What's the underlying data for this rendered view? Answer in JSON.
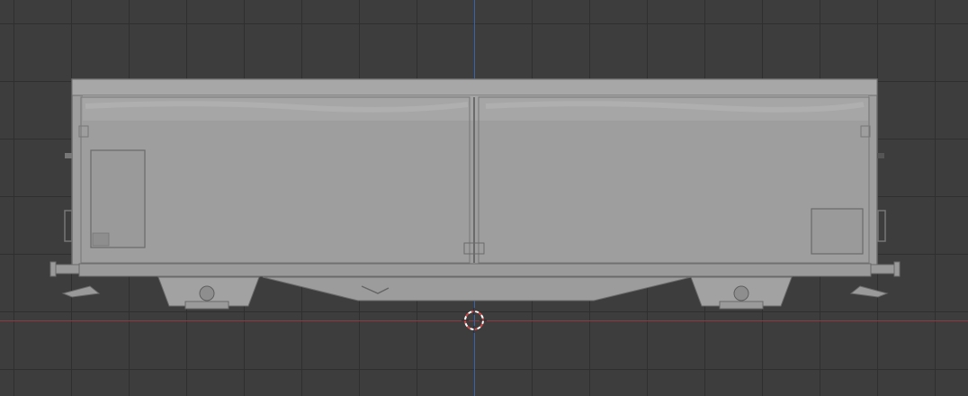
{
  "viewport": {
    "background_color": "#3d3d3d",
    "grid_color": "#2f2f2f",
    "x_axis_color": "#8e3a44",
    "y_axis_color": "#3a62a8"
  },
  "model": {
    "subject": "boxcar-freight-wagon",
    "body_color": "#9c9c9c",
    "shade_color": "#8a8a8a",
    "outline_color": "#6a6a6a"
  },
  "cursor": {
    "icon": "3d-cursor-icon",
    "ring_colors": [
      "#d04a4a",
      "#ffffff"
    ]
  }
}
